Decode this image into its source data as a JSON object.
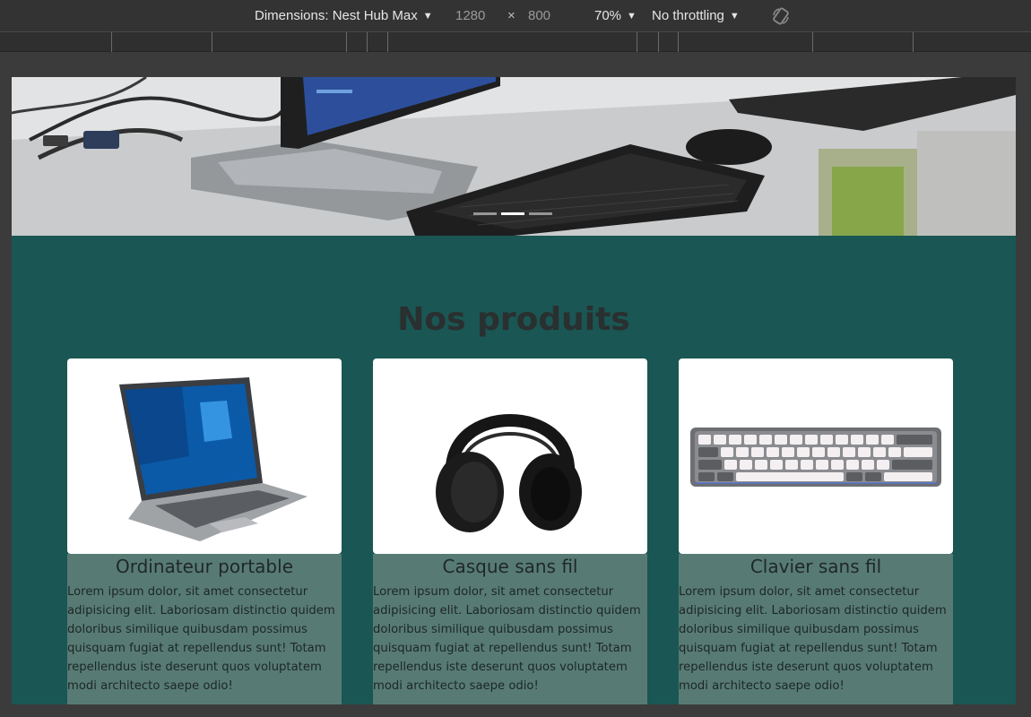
{
  "devtools": {
    "dimensions_label": "Dimensions: Nest Hub Max",
    "width_value": "1280",
    "times_symbol": "×",
    "height_value": "800",
    "zoom": "70%",
    "throttling": "No throttling",
    "rotate_icon": "rotate-icon"
  },
  "hero": {
    "image_icon": "desk-computer-photo",
    "indicator_count": 3,
    "active_indicator": 2
  },
  "products": {
    "title": "Nos produits",
    "items": [
      {
        "name": "Ordinateur portable",
        "description": "Lorem ipsum dolor, sit amet consectetur adipisicing elit. Laboriosam distinctio quidem doloribus similique quibusdam possimus quisquam fugiat at repellendus sunt! Totam repellendus iste deserunt quos voluptatem modi architecto saepe odio!",
        "image_icon": "laptop-image"
      },
      {
        "name": "Casque sans fil",
        "description": "Lorem ipsum dolor, sit amet consectetur adipisicing elit. Laboriosam distinctio quidem doloribus similique quibusdam possimus quisquam fugiat at repellendus sunt! Totam repellendus iste deserunt quos voluptatem modi architecto saepe odio!",
        "image_icon": "headphones-image"
      },
      {
        "name": "Clavier sans fil",
        "description": "Lorem ipsum dolor, sit amet consectetur adipisicing elit. Laboriosam distinctio quidem doloribus similique quibusdam possimus quisquam fugiat at repellendus sunt! Totam repellendus iste deserunt quos voluptatem modi architecto saepe odio!",
        "image_icon": "keyboard-image"
      }
    ]
  },
  "colors": {
    "section_bg": "#1a5653",
    "card_body_bg": "#577b74",
    "devtools_bg": "#333333"
  }
}
